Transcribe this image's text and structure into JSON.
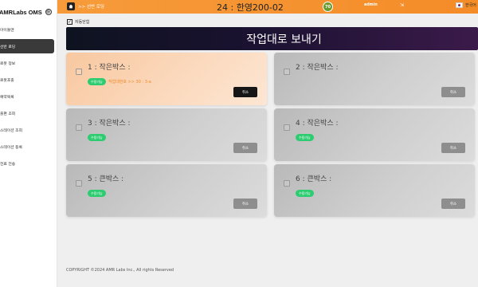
{
  "brand": {
    "name": "AMRLabs OMS",
    "toggle_icon": "⊕"
  },
  "sidebar": {
    "items": [
      {
        "label": "아이들맨",
        "active": false
      },
      {
        "label": "선반 로딩",
        "active": true
      },
      {
        "label": "로봇 정보",
        "active": false
      },
      {
        "label": "로봇호출",
        "active": false
      },
      {
        "label": "예약목록",
        "active": false
      },
      {
        "label": "출편 조회",
        "active": false
      },
      {
        "label": "스테이션 조회",
        "active": false
      },
      {
        "label": "스테이션 등록",
        "active": false
      },
      {
        "label": "전료 전송",
        "active": false
      }
    ]
  },
  "topbar": {
    "breadcrumb": ">> 선반 로딩",
    "station_title": "24 : 한영200-02",
    "logo_text": "70",
    "user": "admin",
    "logout_icon": "⇲",
    "language": "한국어",
    "accent_color": "#f48c28"
  },
  "auto_close": {
    "label": "자동닫힘",
    "checked": true
  },
  "banner": {
    "title": "작업대로 보내기"
  },
  "cards": [
    {
      "title": "1 : 작은박스 :",
      "chip": "수용가능",
      "task": "작업대번호 >> 30 : 3-a",
      "cancel": "취소",
      "highlighted": true
    },
    {
      "title": "2 : 작은박스 :",
      "chip": "",
      "task": "",
      "cancel": "취소",
      "highlighted": false
    },
    {
      "title": "3 : 작은박스 :",
      "chip": "수용가능",
      "task": "",
      "cancel": "취소",
      "highlighted": false
    },
    {
      "title": "4 : 작은박스 :",
      "chip": "수용가능",
      "task": "",
      "cancel": "취소",
      "highlighted": false
    },
    {
      "title": "5 : 큰박스 :",
      "chip": "수용가능",
      "task": "",
      "cancel": "취소",
      "highlighted": false
    },
    {
      "title": "6 : 큰박스 :",
      "chip": "수용가능",
      "task": "",
      "cancel": "취소",
      "highlighted": false
    }
  ],
  "footer": {
    "copyright": "COPYRIGHT ©2024 AMR Labs Inc., All rights Reserved"
  }
}
